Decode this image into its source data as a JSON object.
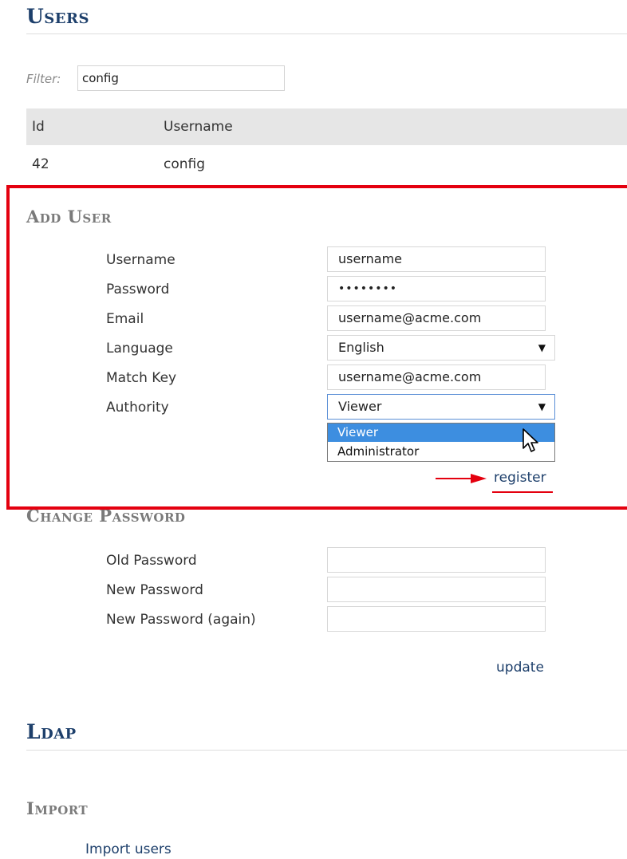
{
  "users_section": {
    "title": "Users",
    "filter_label": "Filter:",
    "filter_value": "config",
    "table": {
      "columns": [
        "Id",
        "Username"
      ],
      "rows": [
        [
          "42",
          "config"
        ]
      ]
    }
  },
  "add_user": {
    "title": "Add User",
    "labels": {
      "username": "Username",
      "password": "Password",
      "email": "Email",
      "language": "Language",
      "match_key": "Match Key",
      "authority": "Authority"
    },
    "values": {
      "username": "username",
      "password": "••••••••",
      "email": "username@acme.com",
      "language": "English",
      "match_key": "username@acme.com",
      "authority": "Viewer"
    },
    "authority_options": [
      "Viewer",
      "Administrator"
    ],
    "register_label": "register",
    "highlight_color": "#e4000f"
  },
  "change_password": {
    "title": "Change Password",
    "labels": {
      "old": "Old Password",
      "new": "New Password",
      "again": "New Password (again)"
    },
    "update_label": "update"
  },
  "ldap": {
    "title": "Ldap",
    "import_title": "Import",
    "import_link": "Import users"
  }
}
